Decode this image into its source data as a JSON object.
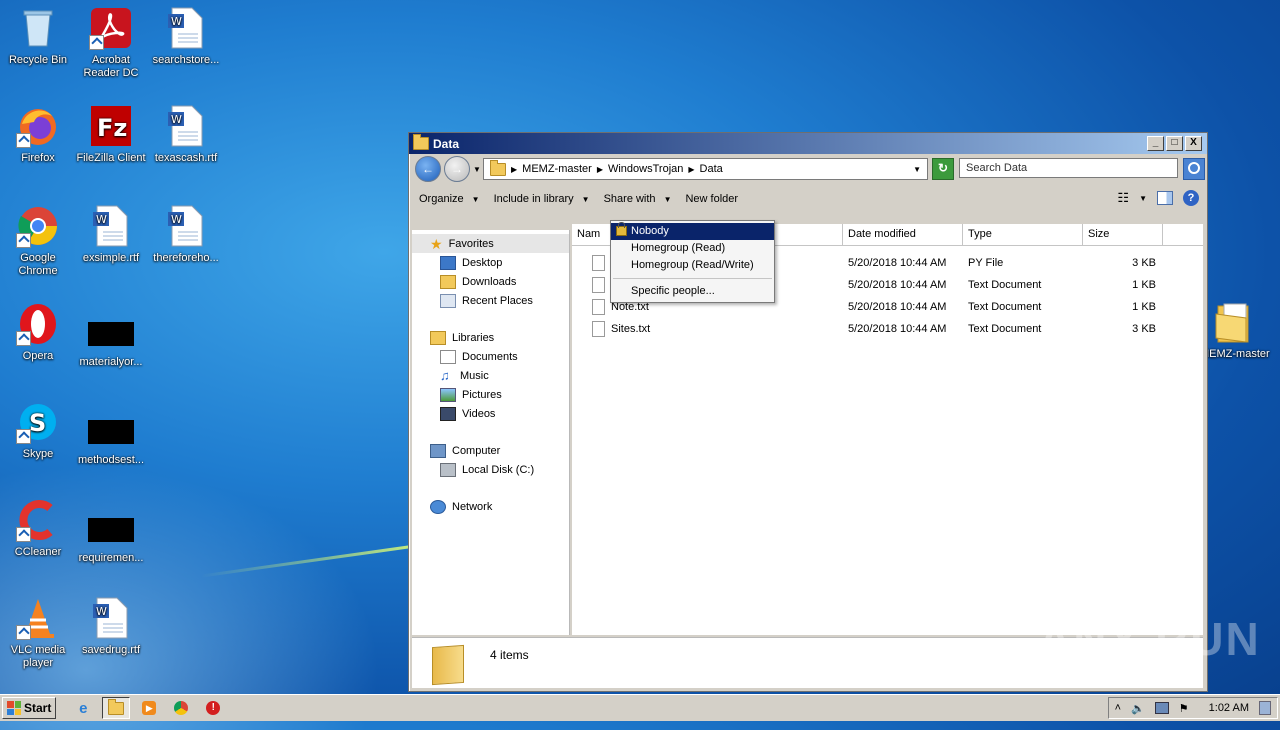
{
  "desktop": {
    "icons": [
      {
        "label": "Recycle Bin"
      },
      {
        "label": "Acrobat Reader DC"
      },
      {
        "label": "searchstore..."
      },
      {
        "label": "Firefox"
      },
      {
        "label": "FileZilla Client"
      },
      {
        "label": "texascash.rtf"
      },
      {
        "label": "Google Chrome"
      },
      {
        "label": "exsimple.rtf"
      },
      {
        "label": "thereforeho..."
      },
      {
        "label": "Opera"
      },
      {
        "label": "materialyor..."
      },
      {
        "label": "Skype"
      },
      {
        "label": "methodsest..."
      },
      {
        "label": "CCleaner"
      },
      {
        "label": "requiremen..."
      },
      {
        "label": "VLC media player"
      },
      {
        "label": "savedrug.rtf"
      },
      {
        "label": "MEMZ-master"
      }
    ]
  },
  "window": {
    "title": "Data",
    "controls": {
      "minimize": "_",
      "maximize": "□",
      "close": "X"
    },
    "address": {
      "crumbs": [
        "MEMZ-master",
        "WindowsTrojan",
        "Data"
      ]
    },
    "search": {
      "placeholder": "Search Data"
    },
    "toolbar": {
      "organize": "Organize",
      "include": "Include in library",
      "share": "Share with",
      "new_folder": "New folder",
      "help": "?"
    },
    "nav": {
      "favorites": "Favorites",
      "desktop": "Desktop",
      "downloads": "Downloads",
      "recent": "Recent Places",
      "libraries": "Libraries",
      "documents": "Documents",
      "music": "Music",
      "pictures": "Pictures",
      "videos": "Videos",
      "computer": "Computer",
      "local_disk": "Local Disk (C:)",
      "network": "Network"
    },
    "columns": {
      "name": "Nam",
      "date": "Date modified",
      "type": "Type",
      "size": "Size"
    },
    "files": [
      {
        "name": "",
        "date": "5/20/2018 10:44 AM",
        "type": "PY File",
        "size": "3 KB"
      },
      {
        "name": "",
        "date": "5/20/2018 10:44 AM",
        "type": "Text Document",
        "size": "1 KB"
      },
      {
        "name": "Note.txt",
        "date": "5/20/2018 10:44 AM",
        "type": "Text Document",
        "size": "1 KB"
      },
      {
        "name": "Sites.txt",
        "date": "5/20/2018 10:44 AM",
        "type": "Text Document",
        "size": "3 KB"
      }
    ],
    "status": {
      "count": "4 items"
    }
  },
  "share_menu": {
    "items": [
      "Nobody",
      "Homegroup (Read)",
      "Homegroup (Read/Write)",
      "Specific people..."
    ]
  },
  "taskbar": {
    "start": "Start",
    "clock": "1:02 AM"
  },
  "watermark": "ANY RUN"
}
